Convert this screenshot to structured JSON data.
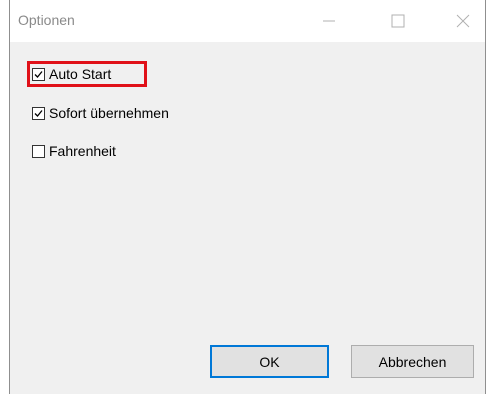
{
  "window": {
    "title": "Optionen",
    "controls": [
      "minimize-icon",
      "maximize-icon",
      "close-icon"
    ]
  },
  "options": [
    {
      "label": "Auto Start",
      "checked": true
    },
    {
      "label": "Sofort übernehmen",
      "checked": true
    },
    {
      "label": "Fahrenheit",
      "checked": false
    }
  ],
  "buttons": {
    "ok_label": "OK",
    "cancel_label": "Abbrechen"
  },
  "colors": {
    "highlight": "#e01018",
    "default_button_border": "#0078d7"
  }
}
